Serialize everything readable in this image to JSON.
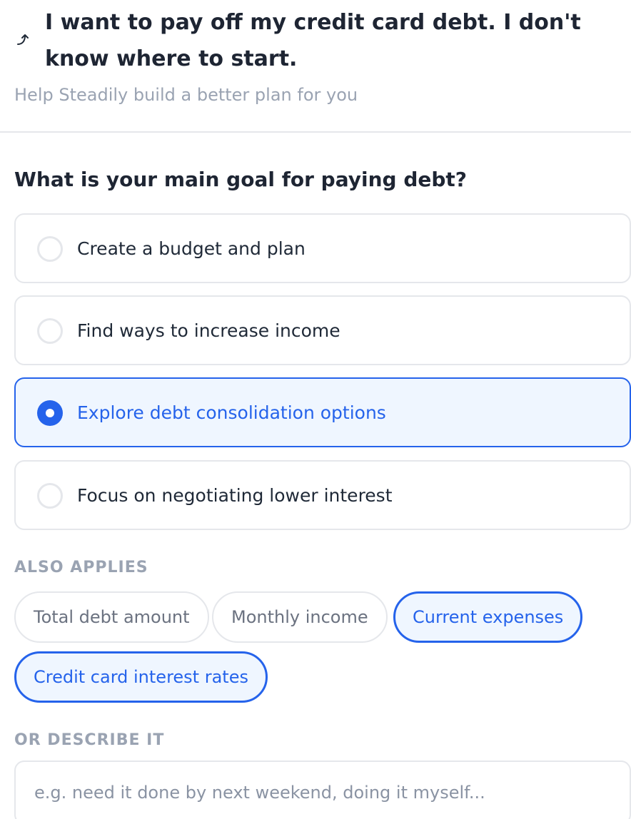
{
  "header": {
    "title": "I want to pay off my credit card debt. I don't know where to start.",
    "subtitle": "Help Steadily build a better plan for you",
    "back_icon": "return-arrow-icon"
  },
  "question": {
    "text": "What is your main goal for paying debt?",
    "options": [
      {
        "label": "Create a budget and plan",
        "selected": false
      },
      {
        "label": "Find ways to increase income",
        "selected": false
      },
      {
        "label": "Explore debt consolidation options",
        "selected": true
      },
      {
        "label": "Focus on negotiating lower interest",
        "selected": false
      }
    ]
  },
  "also_applies": {
    "label": "ALSO APPLIES",
    "chips": [
      {
        "label": "Total debt amount",
        "selected": false
      },
      {
        "label": "Monthly income",
        "selected": false
      },
      {
        "label": "Current expenses",
        "selected": true
      },
      {
        "label": "Credit card interest rates",
        "selected": true
      }
    ]
  },
  "describe": {
    "label": "OR DESCRIBE IT",
    "placeholder": "e.g. need it done by next weekend, doing it myself...",
    "value": ""
  },
  "colors": {
    "accent": "#2563eb",
    "selected_bg": "#eff6ff",
    "border": "#e5e7eb",
    "muted_text": "#9aa3b2"
  }
}
